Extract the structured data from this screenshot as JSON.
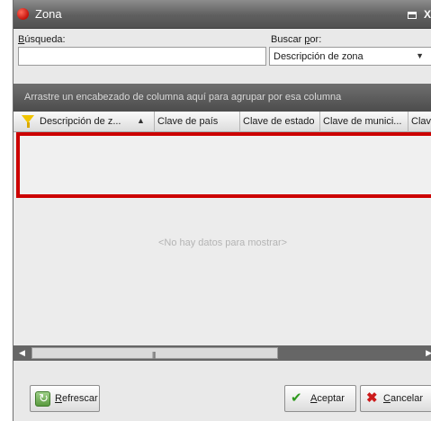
{
  "window": {
    "title": "Zona"
  },
  "search": {
    "label_first": "B",
    "label_rest": "úsqueda:",
    "value": "",
    "placeholder": ""
  },
  "search_by": {
    "label_main": "Buscar ",
    "label_key": "p",
    "label_tail": "or:",
    "selected": "Descripción de zona"
  },
  "grid": {
    "group_hint": "Arrastre un encabezado de columna aquí para agrupar por esa columna",
    "columns": [
      "Descripción de z...",
      "Clave de país",
      "Clave de estado",
      "Clave de munici...",
      "Clav"
    ],
    "empty_message": "<No hay datos para mostrar>"
  },
  "buttons": {
    "refresh": {
      "key": "R",
      "rest": "efrescar"
    },
    "accept": {
      "key": "A",
      "rest": "ceptar"
    },
    "cancel": {
      "key": "C",
      "rest": "ancelar"
    }
  },
  "colors": {
    "highlight": "#cc0000",
    "title_bar": "#5f5f5f",
    "group_panel": "#4c4c4c"
  }
}
